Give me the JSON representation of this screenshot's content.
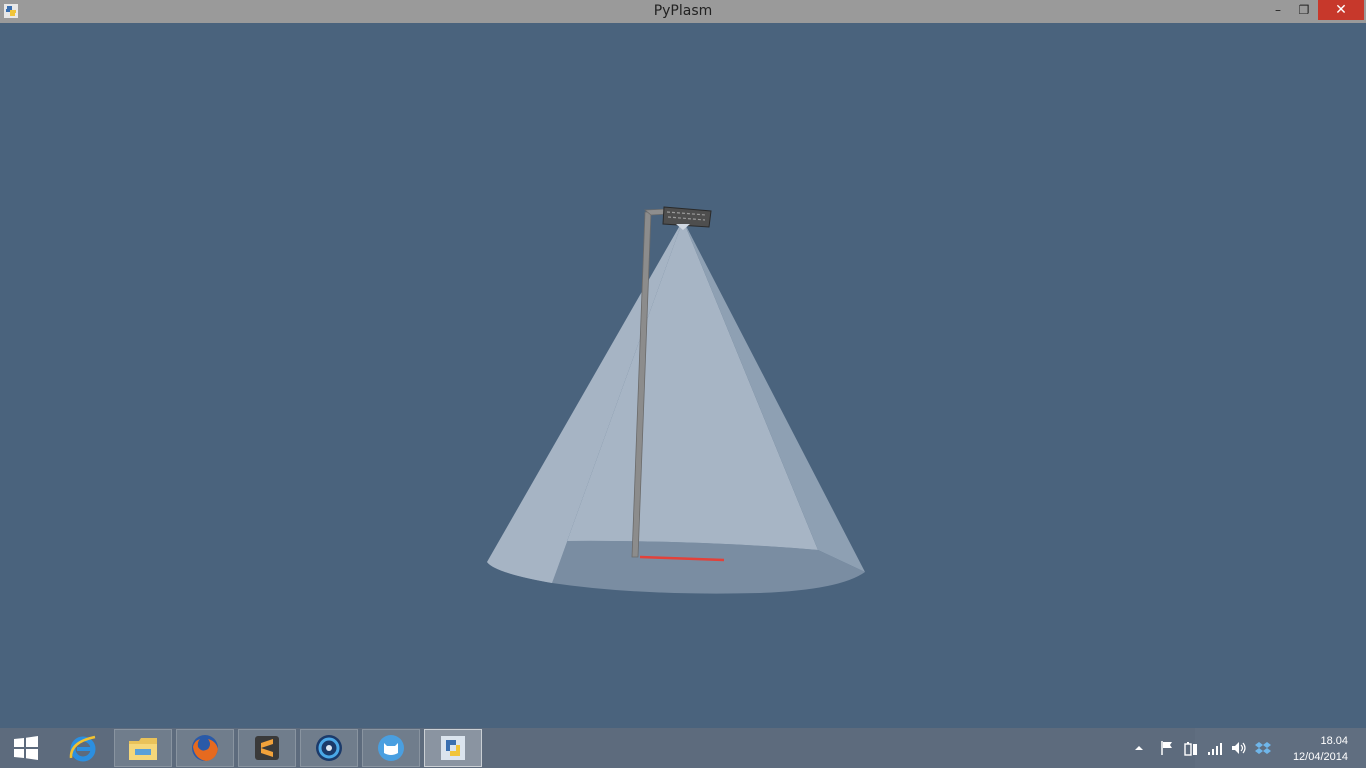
{
  "window": {
    "title": "PyPlasm",
    "minimize_glyph": "–",
    "maximize_glyph": "❐",
    "close_glyph": "✕"
  },
  "scene": {
    "background": "#4a637d",
    "objects": [
      "street-lamp-pole",
      "lamp-head",
      "light-cone",
      "ground-disc",
      "red-axis-line"
    ]
  },
  "taskbar": {
    "start_icon": "windows-logo-icon",
    "apps": [
      {
        "name": "internet-explorer",
        "icon": "ie-icon",
        "state": "pinned"
      },
      {
        "name": "file-explorer",
        "icon": "folder-icon",
        "state": "pinned"
      },
      {
        "name": "firefox",
        "icon": "firefox-icon",
        "state": "pinned"
      },
      {
        "name": "sublime-text",
        "icon": "sublime-icon",
        "state": "pinned"
      },
      {
        "name": "media-app",
        "icon": "disc-icon",
        "state": "pinned"
      },
      {
        "name": "cat-app",
        "icon": "cat-icon",
        "state": "pinned"
      },
      {
        "name": "python",
        "icon": "python-icon",
        "state": "active"
      }
    ],
    "tray_icons": [
      "show-hidden-icon",
      "flag-icon",
      "battery-icon",
      "signal-icon",
      "volume-icon",
      "dropbox-icon"
    ],
    "clock": {
      "time": "18.04",
      "date": "12/04/2014"
    }
  }
}
